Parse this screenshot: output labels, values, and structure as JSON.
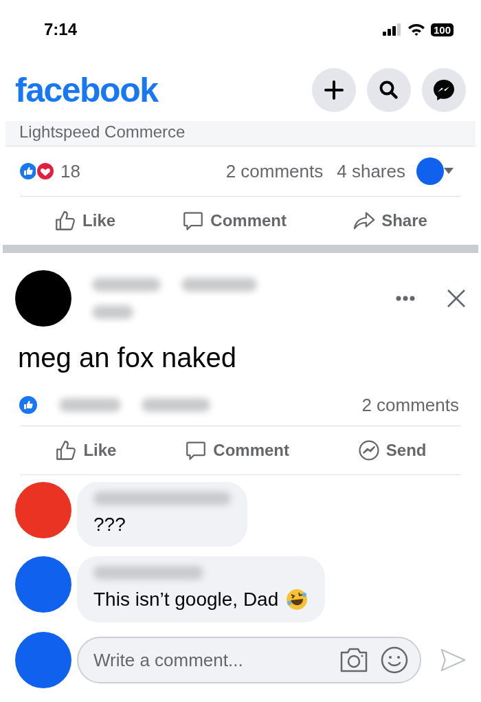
{
  "status_bar": {
    "time": "7:14",
    "battery": "100"
  },
  "header": {
    "logo": "facebook"
  },
  "previous_post": {
    "link_source": "Lightspeed Commerce",
    "reaction_count": "18",
    "comments": "2 comments",
    "shares": "4 shares",
    "sharer_avatar": {
      "color": "#1062ee"
    },
    "actions": [
      "Like",
      "Comment",
      "Share"
    ]
  },
  "post": {
    "author_avatar": {
      "color": "#000000"
    },
    "text": "meg an fox naked",
    "comments": "2 comments",
    "actions": [
      "Like",
      "Comment",
      "Send"
    ],
    "comment_list": [
      {
        "color": "#ea3323",
        "text": "???",
        "emoji": false
      },
      {
        "color": "#1062ee",
        "text": "This isn’t google, Dad",
        "emoji": true
      }
    ]
  },
  "composer": {
    "avatar": {
      "color": "#1062ee"
    },
    "placeholder": "Write a comment..."
  }
}
